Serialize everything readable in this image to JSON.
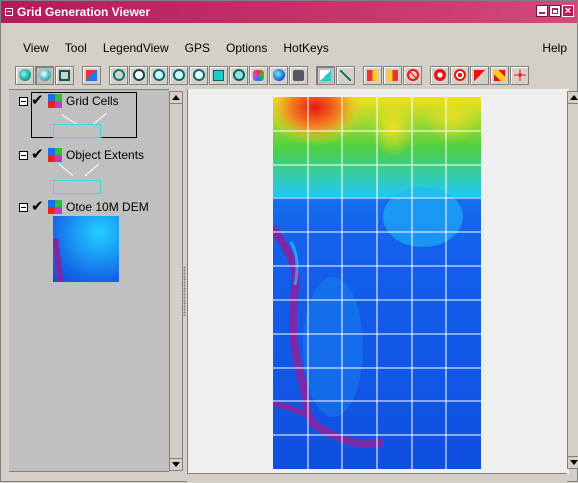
{
  "window": {
    "title": "Grid Generation Viewer"
  },
  "menu": {
    "items": [
      "View",
      "Tool",
      "LegendView",
      "GPS",
      "Options",
      "HotKeys"
    ],
    "help": "Help"
  },
  "toolbar": {
    "icons": [
      "select-tool-icon",
      "identify-tool-icon",
      "window-tool-icon",
      "add-layer-icon",
      "pan-icon",
      "zoom-full-icon",
      "zoom-in-icon",
      "zoom-out-icon",
      "zoom-previous-icon",
      "zoom-to-layer-icon",
      "recenter-icon",
      "overview-icon",
      "globe-icon",
      "camera-icon",
      "scale-1-icon",
      "measure-icon",
      "back-icon",
      "forward-icon",
      "stop-icon",
      "cancel-red-icon",
      "target-red-icon",
      "pointer-icon",
      "pencil-icon",
      "crosshair-icon"
    ]
  },
  "legend": {
    "layers": [
      {
        "name": "Grid Cells",
        "checked": true
      },
      {
        "name": "Object Extents",
        "checked": true
      },
      {
        "name": "Otoe 10M DEM",
        "checked": true
      }
    ],
    "swatch_color": "#40d8d8"
  },
  "map": {
    "grid_color": "#ffffff",
    "grid_columns": 6,
    "grid_rows": 11,
    "colors": {
      "high": "#e81818",
      "mid_high": "#f0e020",
      "mid": "#40d040",
      "low": "#20c8f8",
      "lowest": "#1457ee",
      "river": "#7a2aa8"
    }
  }
}
